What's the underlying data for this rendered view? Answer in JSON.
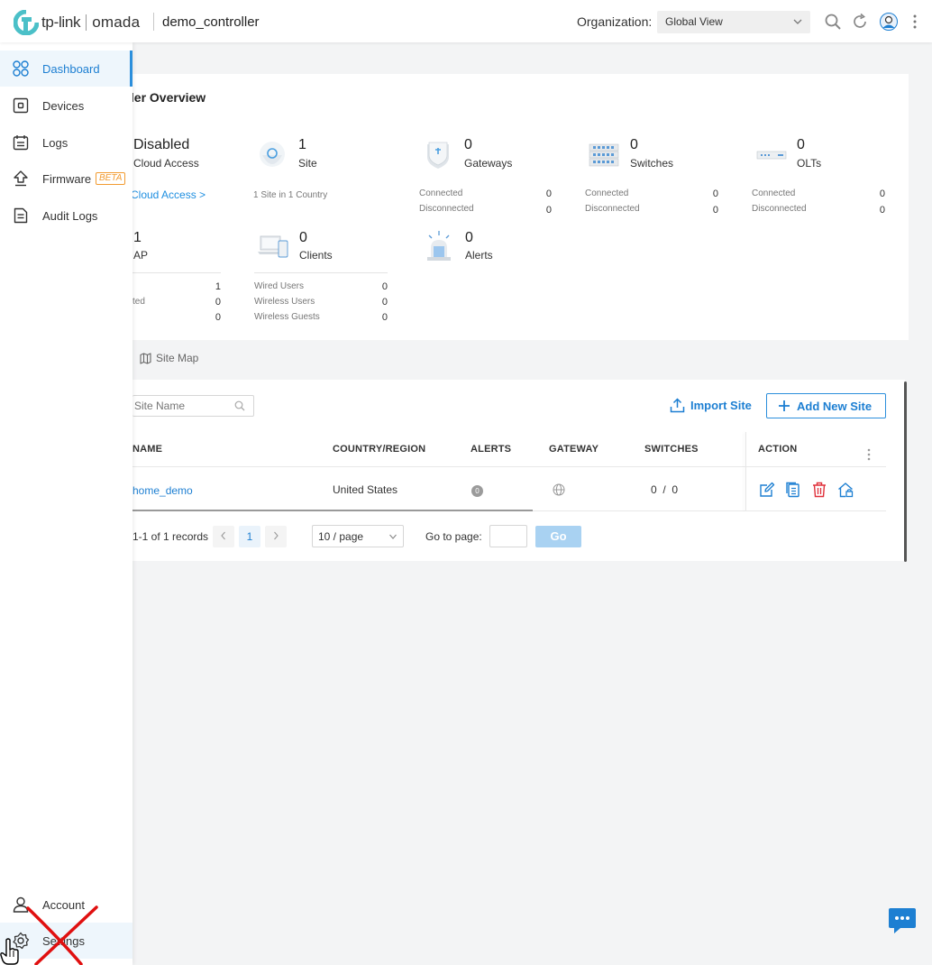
{
  "header": {
    "brand": "tp-link",
    "product": "omada",
    "controller_name": "demo_controller",
    "org_label": "Organization:",
    "org_value": "Global View"
  },
  "sidebar": {
    "items": [
      {
        "label": "Dashboard",
        "icon": "dashboard-icon",
        "active": true
      },
      {
        "label": "Devices",
        "icon": "devices-icon"
      },
      {
        "label": "Logs",
        "icon": "logs-icon"
      },
      {
        "label": "Firmware",
        "icon": "firmware-icon",
        "badge": "BETA"
      },
      {
        "label": "Audit Logs",
        "icon": "audit-logs-icon"
      }
    ],
    "bottom": [
      {
        "label": "Account",
        "icon": "account-icon"
      },
      {
        "label": "Settings",
        "icon": "settings-icon"
      }
    ]
  },
  "overview": {
    "title": "ller Overview",
    "cloud": {
      "value": "Disabled",
      "label": "Cloud Access",
      "link": "Cloud Access >"
    },
    "site": {
      "value": "1",
      "label": "Site",
      "sub": "1 Site in 1 Country"
    },
    "gateways": {
      "value": "0",
      "label": "Gateways",
      "connected_label": "Connected",
      "connected": "0",
      "disconnected_label": "Disconnected",
      "disconnected": "0"
    },
    "switches": {
      "value": "0",
      "label": "Switches",
      "connected_label": "Connected",
      "connected": "0",
      "disconnected_label": "Disconnected",
      "disconnected": "0"
    },
    "olts": {
      "value": "0",
      "label": "OLTs",
      "connected_label": "Connected",
      "connected": "0",
      "disconnected_label": "Disconnected",
      "disconnected": "0"
    },
    "ap": {
      "value": "1",
      "label": "AP",
      "row1": "1",
      "row2_label": "ted",
      "row2": "0",
      "row3": "0"
    },
    "clients": {
      "value": "0",
      "label": "Clients",
      "wired_label": "Wired Users",
      "wired": "0",
      "wireless_label": "Wireless Users",
      "wireless": "0",
      "guests_label": "Wireless Guests",
      "guests": "0"
    },
    "alerts": {
      "value": "0",
      "label": "Alerts"
    }
  },
  "tabs": {
    "site_map": "Site Map"
  },
  "table": {
    "search_placeholder": "Site Name",
    "import_label": "Import Site",
    "add_label": "Add New Site",
    "columns": [
      "NAME",
      "COUNTRY/REGION",
      "ALERTS",
      "GATEWAY",
      "SWITCHES",
      "ACTION"
    ],
    "rows": [
      {
        "name": "home_demo",
        "country": "United States",
        "alerts": "0",
        "switches": "0  /  0"
      }
    ]
  },
  "pagination": {
    "summary": "1-1 of 1 records",
    "current_page": "1",
    "per_page": "10 / page",
    "goto_label": "Go to page:",
    "go_label": "Go"
  },
  "colors": {
    "accent": "#1d7fd2",
    "delete": "#e0303a",
    "beta": "#f29b30"
  }
}
